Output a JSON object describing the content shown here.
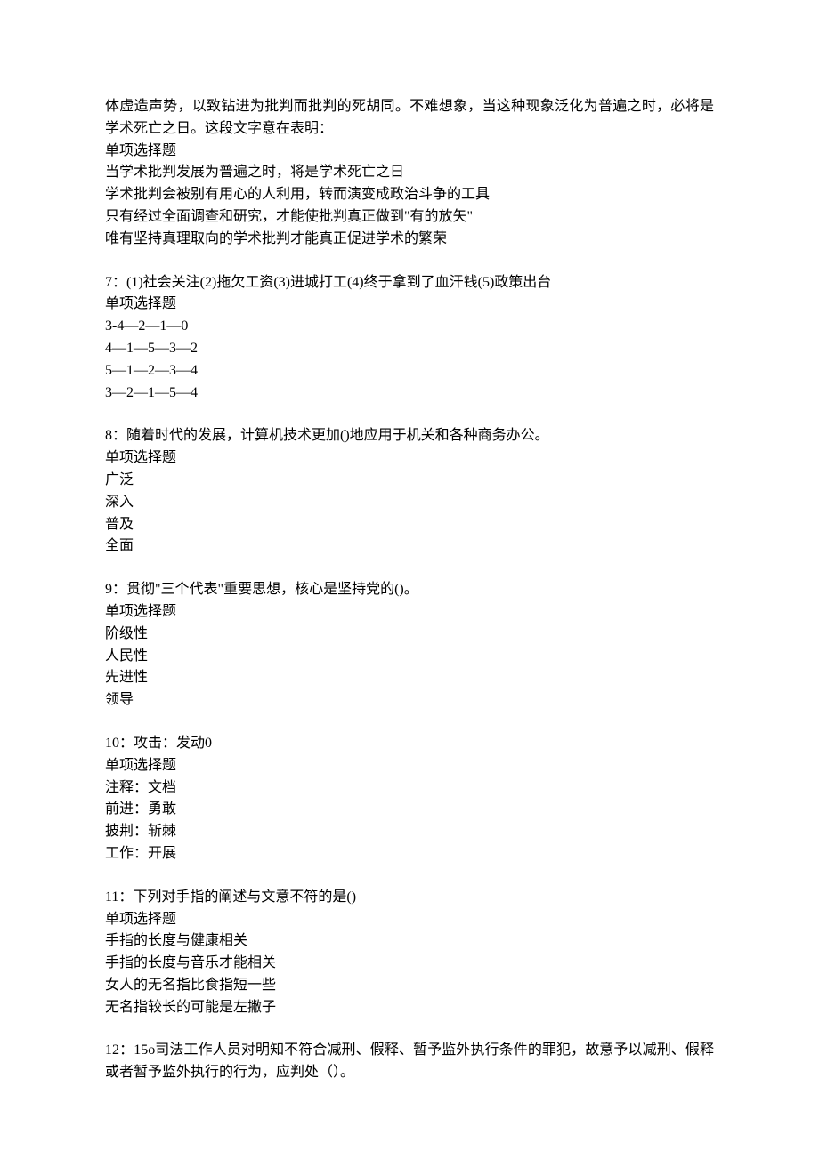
{
  "intro": {
    "lines": [
      "体虚造声势，以致钻进为批判而批判的死胡同。不难想象，当这种现象泛化为普遍之时，必将是学术死亡之日。这段文字意在表明：",
      "单项选择题",
      "当学术批判发展为普遍之时，将是学术死亡之日",
      "学术批判会被别有用心的人利用，转而演变成政治斗争的工具",
      "只有经过全面调查和研究，才能使批判真正做到\"有的放矢\"",
      "唯有坚持真理取向的学术批判才能真正促进学术的繁荣"
    ]
  },
  "q7": {
    "stem": "7：(1)社会关注(2)拖欠工资(3)进城打工(4)终于拿到了血汗钱(5)政策出台",
    "type": "单项选择题",
    "opts": [
      "3-4—2—1—0",
      "4—1—5—3—2",
      "5—1—2—3—4",
      "3—2—1—5—4"
    ]
  },
  "q8": {
    "stem": "8：随着时代的发展，计算机技术更加()地应用于机关和各种商务办公。",
    "type": "单项选择题",
    "opts": [
      "广泛",
      "深入",
      "普及",
      "全面"
    ]
  },
  "q9": {
    "stem": "9：贯彻\"三个代表\"重要思想，核心是坚持党的()。",
    "type": "单项选择题",
    "opts": [
      "阶级性",
      "人民性",
      "先进性",
      "领导"
    ]
  },
  "q10": {
    "stem": "10：攻击：发动0",
    "type": "单项选择题",
    "opts": [
      "注释：文档",
      "前进：勇敢",
      "披荆：斩棘",
      "工作：开展"
    ]
  },
  "q11": {
    "stem": "11：下列对手指的阐述与文意不符的是()",
    "type": "单项选择题",
    "opts": [
      "手指的长度与健康相关",
      "手指的长度与音乐才能相关",
      "女人的无名指比食指短一些",
      "无名指较长的可能是左撇子"
    ]
  },
  "q12": {
    "stem": "12：15o司法工作人员对明知不符合减刑、假释、暂予监外执行条件的罪犯，故意予以减刑、假释或者暂予监外执行的行为，应判处（）。"
  }
}
